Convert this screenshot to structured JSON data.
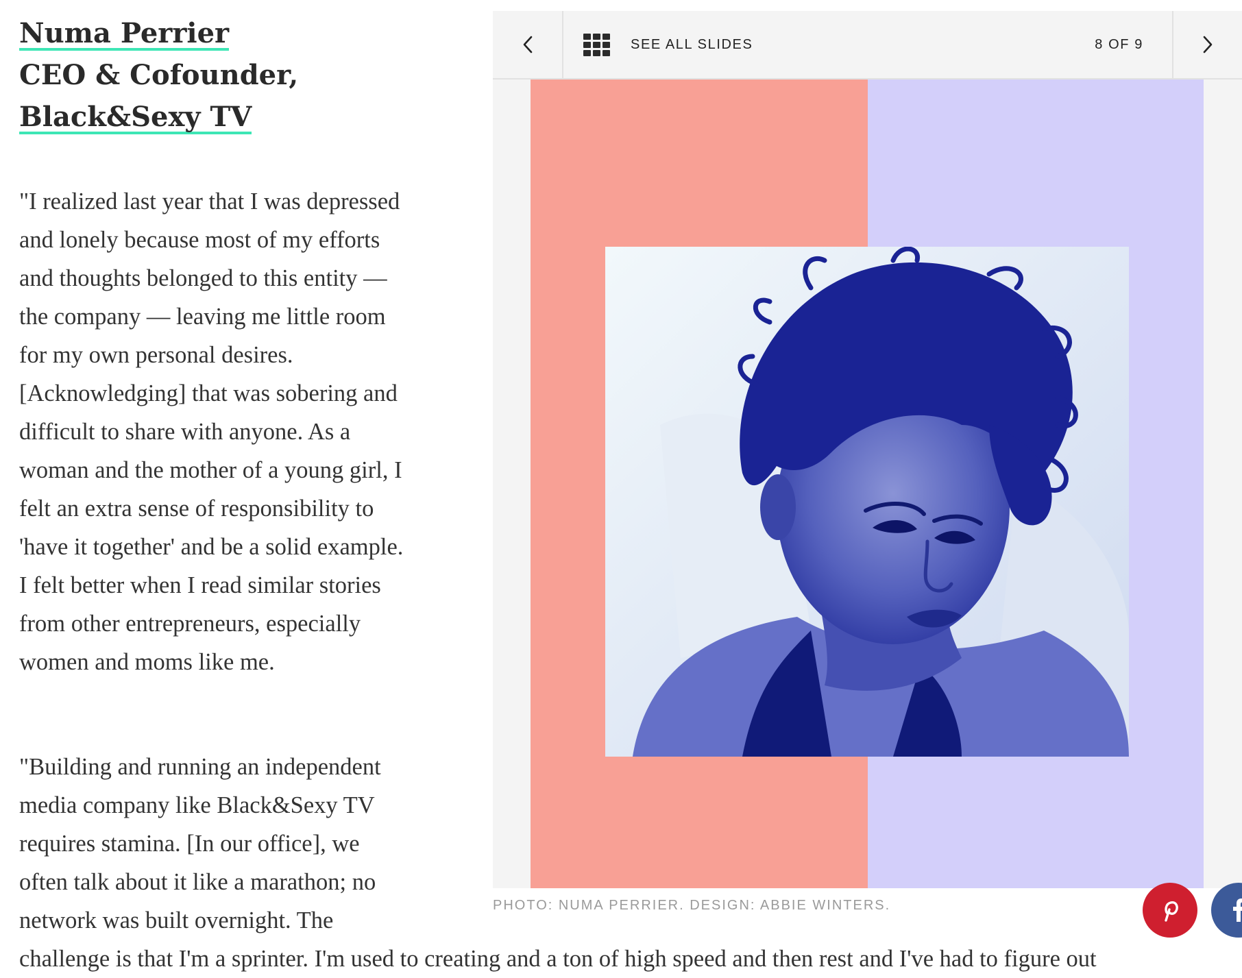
{
  "profile": {
    "name": "Numa Perrier",
    "role": "CEO & Cofounder,",
    "company": "Black&Sexy TV"
  },
  "quote_lines": [
    "\"I realized last year that I was depressed",
    "and lonely because most of my efforts",
    "and thoughts belonged to this entity —",
    "the company — leaving me little room",
    "for my own personal desires.",
    "[Acknowledging] that was sobering and",
    "difficult to share with anyone. As a",
    "woman and the mother of a young girl, I",
    "felt an extra sense of responsibility to",
    "'have it together' and be a solid example.",
    "I felt better when I read similar stories",
    "from other entrepreneurs, especially",
    "women and moms like me.",
    "",
    "\"Building and running an independent",
    "media company like Black&Sexy TV",
    "requires stamina. [In our office], we",
    "often talk about it like a marathon; no",
    "network was built overnight. The",
    "challenge is that I'm a sprinter. I'm used to creating and a ton of high speed and then rest and I've had to figure out"
  ],
  "slideshow": {
    "see_all_label": "SEE ALL SLIDES",
    "counter": "8 OF 9",
    "prev_icon": "chevron-left-icon",
    "next_icon": "chevron-right-icon",
    "grid_icon": "grid-icon",
    "colors": {
      "left_panel": "#f8a095",
      "right_panel": "#d3cffa",
      "photo_tint": "#2a3aa8"
    },
    "share": {
      "pinterest_color": "#cf1f2f",
      "facebook_color": "#3c5a99"
    }
  },
  "caption": "PHOTO: NUMA PERRIER. DESIGN: ABBIE WINTERS."
}
